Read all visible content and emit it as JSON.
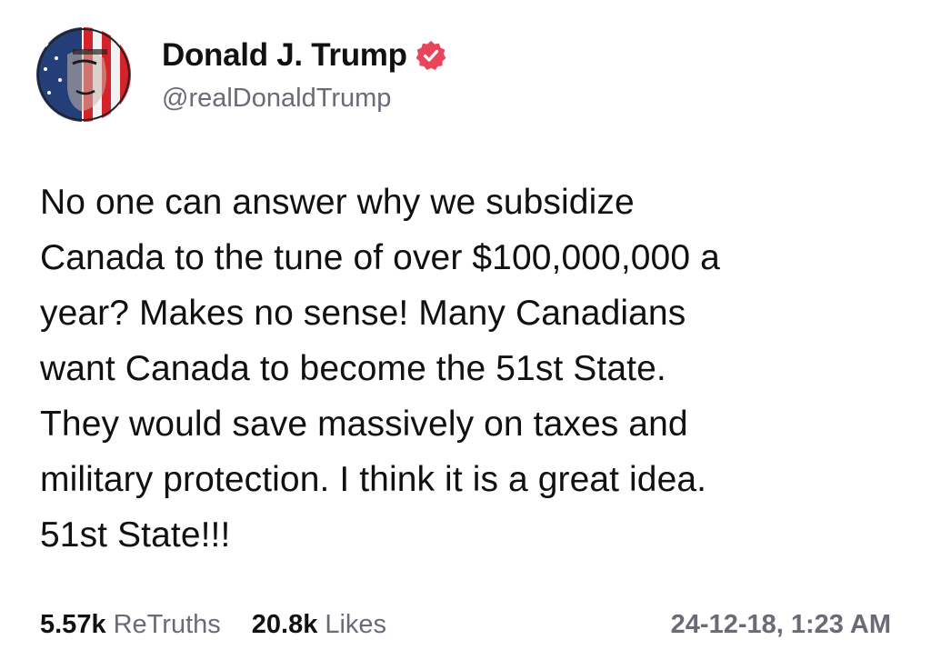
{
  "author": {
    "display_name": "Donald J. Trump",
    "handle": "@realDonaldTrump",
    "verified_icon": "verified-badge-icon",
    "avatar": "avatar-image"
  },
  "post": {
    "text": "No one can answer why we subsidize\nCanada to the tune of over $100,000,000 a\nyear? Makes no sense! Many Canadians\nwant Canada to become the 51st State.\nThey would save massively on taxes and\nmilitary protection. I think it is a great idea.\n51st State!!!"
  },
  "stats": {
    "retruths_count": "5.57k",
    "retruths_label": "ReTruths",
    "likes_count": "20.8k",
    "likes_label": "Likes",
    "timestamp": "24-12-18, 1:23 AM"
  },
  "colors": {
    "badge": "#e8445a",
    "text": "#111111",
    "muted": "#6b6b78",
    "background": "#ffffff"
  }
}
